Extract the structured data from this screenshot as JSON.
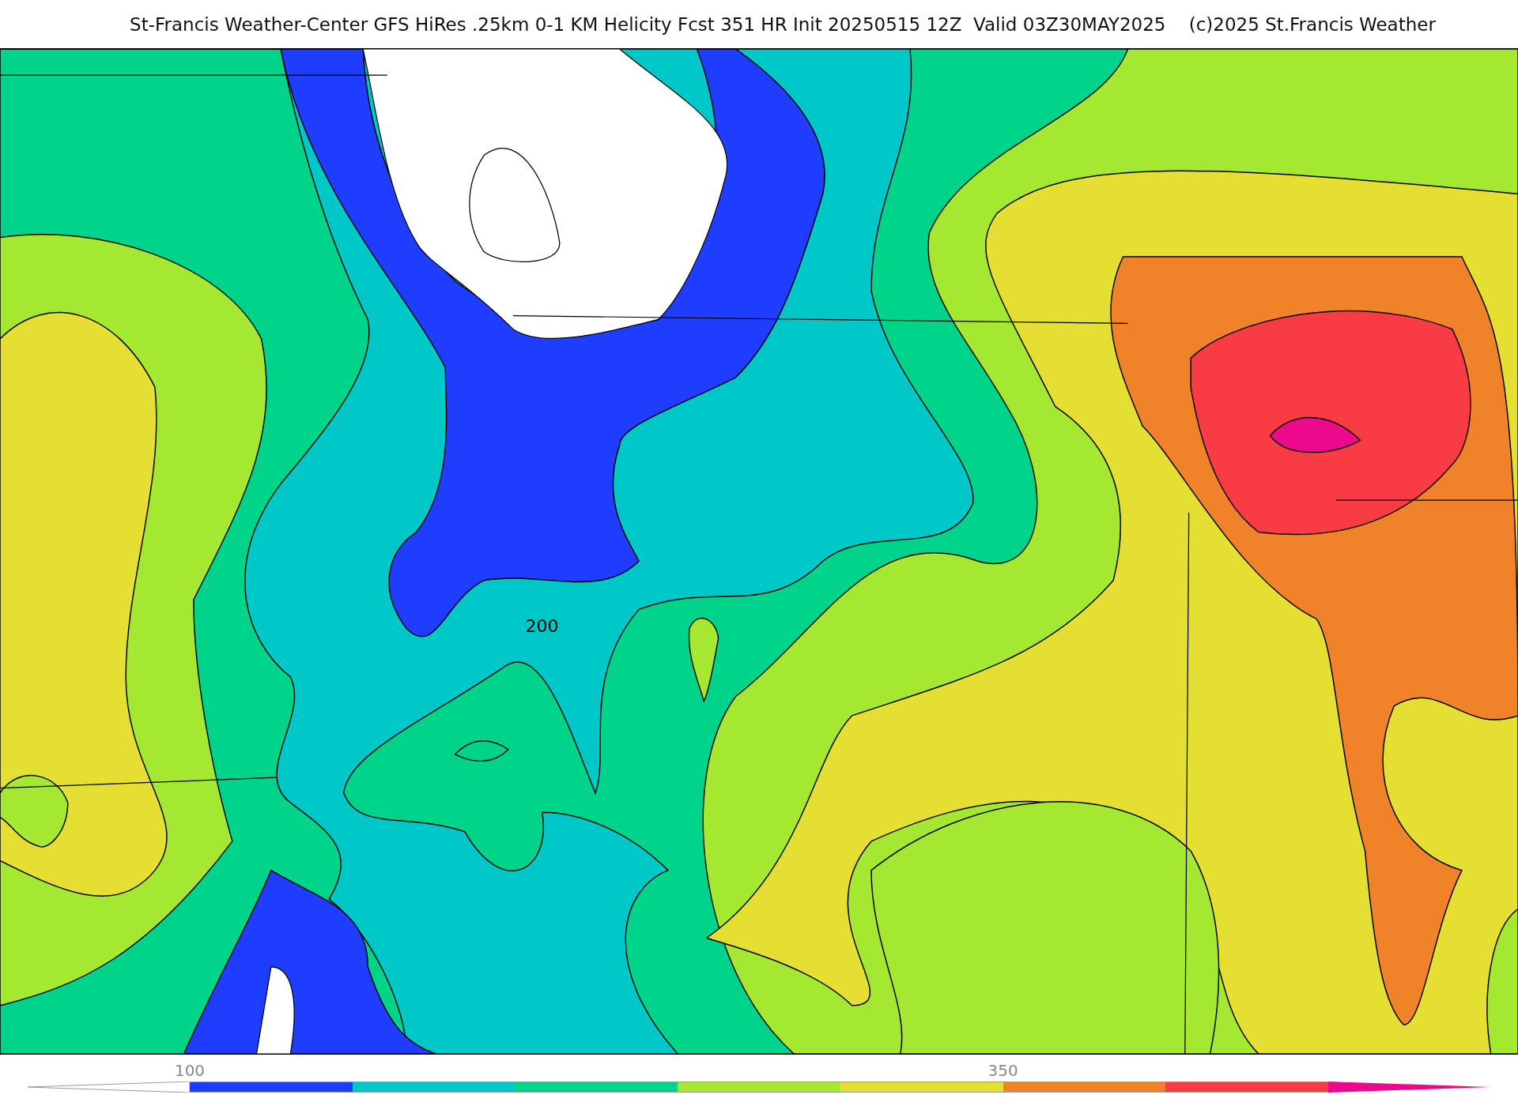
{
  "title": "St-Francis Weather-Center GFS HiRes .25km 0-1 KM Helicity Fcst 351 HR Init 20250515 12Z  Valid 03Z30MAY2025    (c)2025 St.Francis Weather",
  "map": {
    "contour_label": "200"
  },
  "colorbar": {
    "under": {
      "color": "#ffffff"
    },
    "over": {
      "color": "#ec0a8c"
    },
    "segments": [
      {
        "color": "#1f3dff",
        "label": "100"
      },
      {
        "color": "#00c8c8"
      },
      {
        "color": "#00d48a"
      },
      {
        "color": "#a4e832"
      },
      {
        "color": "#e4df32"
      },
      {
        "color": "#f0822a",
        "label": "350"
      },
      {
        "color": "#f93c44"
      }
    ]
  }
}
